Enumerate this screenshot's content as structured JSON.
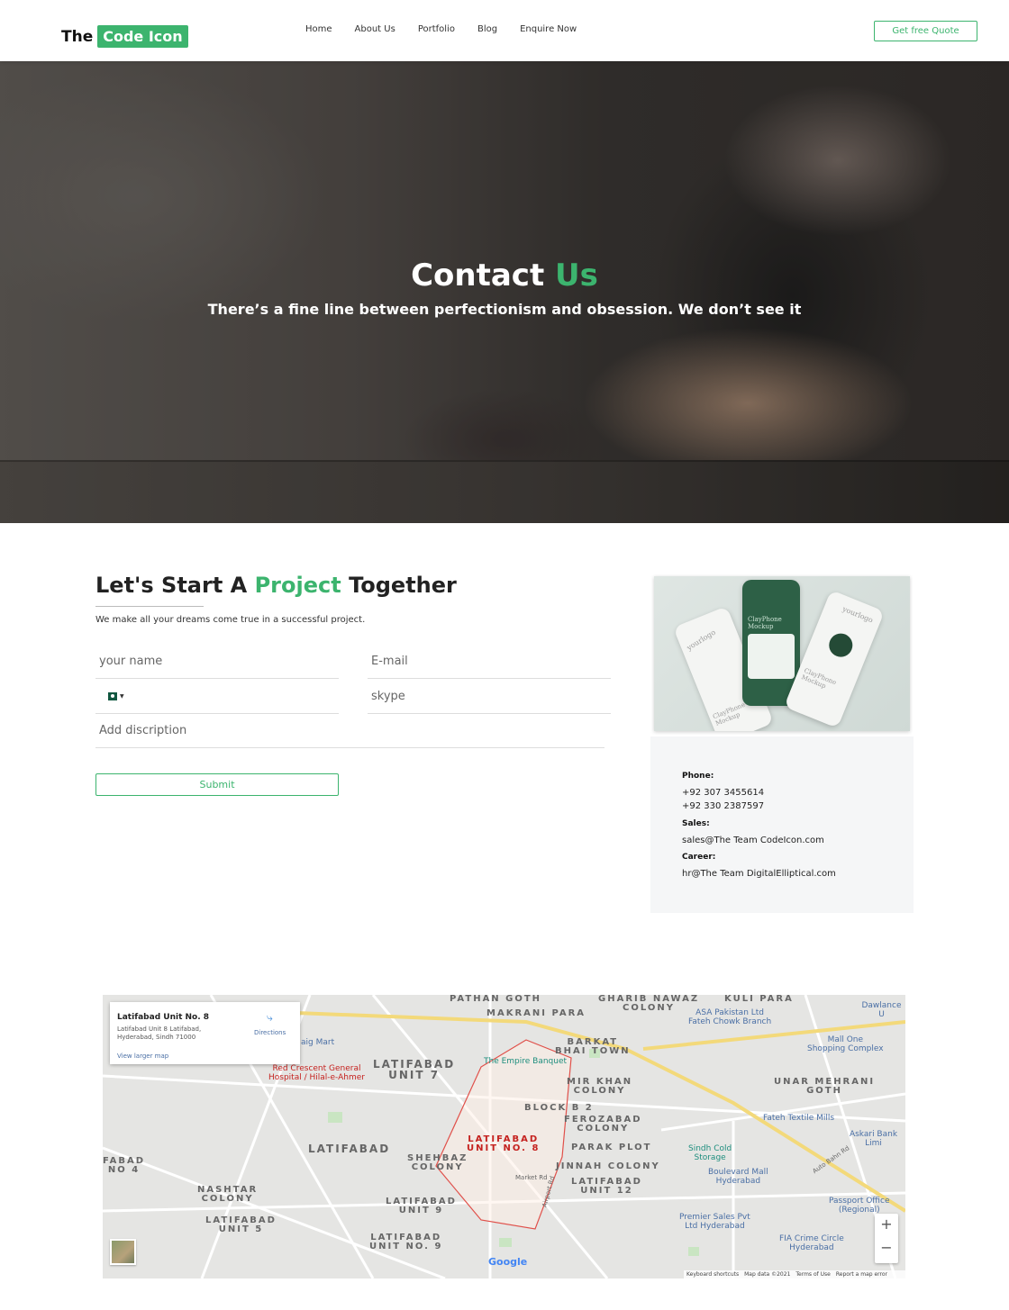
{
  "header": {
    "logo_the": "The",
    "logo_box": "Code Icon",
    "nav": [
      "Home",
      "About Us",
      "Portfolio",
      "Blog",
      "Enquire Now"
    ],
    "quote_button": "Get free Quote"
  },
  "hero": {
    "title_main": "Contact",
    "title_accent": "Us",
    "subtitle": "There’s a fine line between perfectionism and obsession. We don’t see it"
  },
  "form_section": {
    "title_start": "Let's Start A",
    "title_accent": "Project",
    "title_end": "Together",
    "description": "We make all your dreams come true in a successful project.",
    "name_placeholder": "your name",
    "email_placeholder": "E-mail",
    "phone_value": "",
    "skype_placeholder": "skype",
    "description_placeholder": "Add discription",
    "submit_label": "Submit"
  },
  "mockup": {
    "texts": [
      "yourlogo",
      "yourlogo",
      "ClayPhone Mockup",
      "ClayPhone Mockup",
      "ClayPhone Mockup"
    ]
  },
  "contact": {
    "phone_label": "Phone:",
    "phone_1": "+92 307 3455614",
    "phone_2": "+92 330 2387597",
    "sales_label": "Sales:",
    "sales_email": "sales@The Team CodeIcon.com",
    "career_label": "Career:",
    "career_email": "hr@The Team DigitalElliptical.com"
  },
  "map": {
    "info_title": "Latifabad Unit No. 8",
    "info_address_1": "Latifabad Unit 8 Latifabad,",
    "info_address_2": "Hyderabad, Sindh 71000",
    "directions": "Directions",
    "larger_map": "View larger map",
    "labels": {
      "pathan_goth": "PATHAN GOTH",
      "gharib_nawaz": "GHARIB NAWAZ\nCOLONY",
      "kuli_para": "KULI PARA",
      "makrani_para": "MAKRANI PARA",
      "latifabad_7": "LATIFABAD\nUNIT 7",
      "barkat_bhai": "BARKAT\nBHAI TOWN",
      "mir_khan": "MIR KHAN\nCOLONY",
      "unar_mehrani": "UNAR MEHRANI\nGOTH",
      "block_b2": "BLOCK B 2",
      "ferozabad": "FEROZABAD\nCOLONY",
      "latifabad": "LATIFABAD",
      "latifabad_8": "LATIFABAD\nUNIT NO. 8",
      "shehbaz": "SHEHBAZ\nCOLONY",
      "parak_plot": "PARAK PLOT",
      "jinnah": "JINNAH COLONY",
      "latifabad_12": "LATIFABAD\nUNIT 12",
      "fabad_4": "FABAD\nNO 4",
      "nashtar": "NASHTAR\nCOLONY",
      "latifabad_9": "LATIFABAD\nUNIT 9",
      "latifabad_5": "LATIFABAD\nUNIT 5",
      "latifabad_no9": "LATIFABAD\nUNIT NO. 9",
      "dawlance": "Dawlance U",
      "asa_pakistan": "ASA Pakistan Ltd\nFateh Chowk Branch",
      "mall_one": "Mall One\nShopping Complex",
      "empire_banquet": "The Empire Banquet",
      "red_crescent": "Red Crescent General\nHospital / Hilal-e-Ahmer",
      "aig_mart": "aig Mart",
      "fateh_textile": "Fateh Textile Mills",
      "askari": "Askari Bank Limi",
      "sindh_cold": "Sindh Cold\nStorage",
      "boulevard": "Boulevard Mall\nHyderabad",
      "passport": "Passport Office\n(Regional)",
      "premier": "Premier Sales Pvt\nLtd Hyderabad",
      "fia": "FIA Crime Circle\nHyderabad",
      "market_rd": "Market Rd",
      "airport_rd": "Airport Rd",
      "auto_bahn": "Auto Bahn Rd"
    },
    "footer": [
      "Keyboard shortcuts",
      "Map data ©2021",
      "Terms of Use",
      "Report a map error"
    ],
    "google": "Google"
  },
  "colors": {
    "accent": "#3cb46e"
  }
}
